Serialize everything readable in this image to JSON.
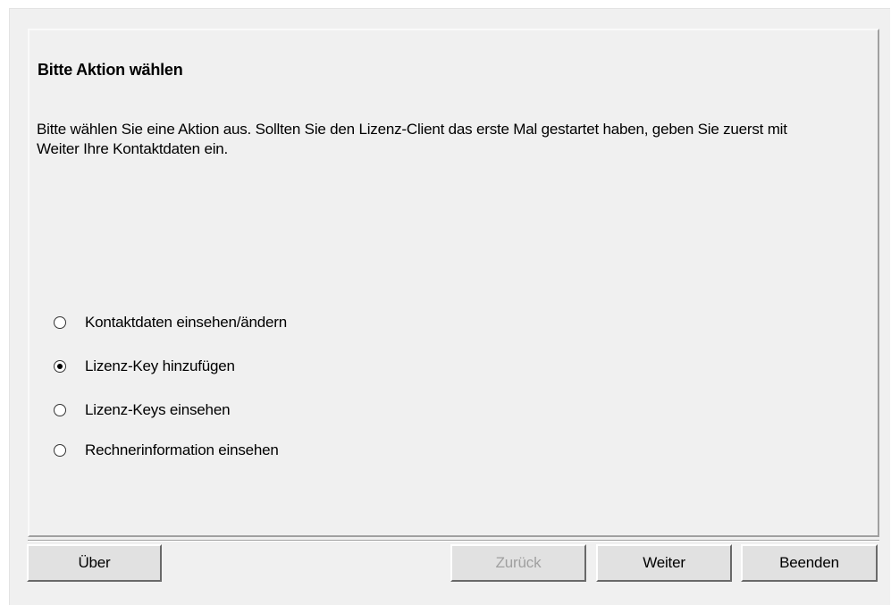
{
  "page": {
    "title": "Bitte Aktion wählen",
    "description": "Bitte wählen Sie eine Aktion aus. Sollten Sie den Lizenz-Client das erste Mal gestartet haben, geben Sie zuerst mit Weiter Ihre Kontaktdaten ein."
  },
  "options": [
    {
      "label": "Kontaktdaten einsehen/ändern",
      "selected": false
    },
    {
      "label": "Lizenz-Key hinzufügen",
      "selected": true
    },
    {
      "label": "Lizenz-Keys einsehen",
      "selected": false
    },
    {
      "label": "Rechnerinformation einsehen",
      "selected": false
    }
  ],
  "buttons": {
    "about": "Über",
    "back": "Zurück",
    "back_enabled": false,
    "next": "Weiter",
    "exit": "Beenden"
  },
  "colors": {
    "window_bg": "#f0f0f0",
    "button_face": "#e1e1e1",
    "disabled_text": "#a0a0a0"
  }
}
